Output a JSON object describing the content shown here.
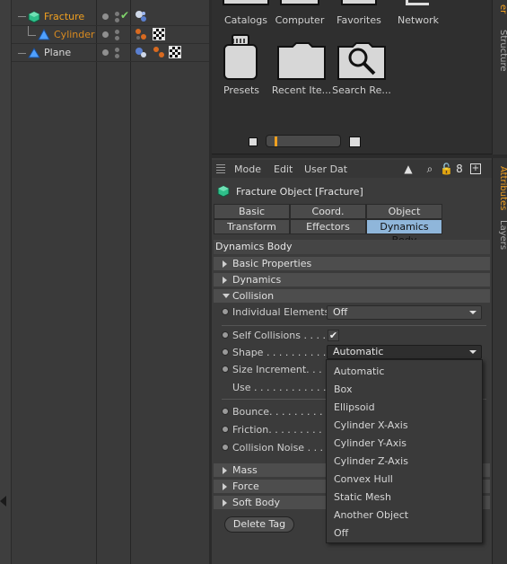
{
  "object_manager": {
    "objects": [
      {
        "name": "Fracture",
        "color": "#f0a020"
      },
      {
        "name": "Cylinder",
        "color": "#d88a20"
      },
      {
        "name": "Plane",
        "color": "#d8d8d8"
      }
    ]
  },
  "content_browser": {
    "items_row1": [
      {
        "label": "Catalogs",
        "icon": "catalogs-icon"
      },
      {
        "label": "Computer",
        "icon": "computer-icon"
      },
      {
        "label": "Favorites",
        "icon": "favorites-icon"
      },
      {
        "label": "Network",
        "icon": "network-icon"
      }
    ],
    "items_row2": [
      {
        "label": "Presets",
        "icon": "presets-jar-icon"
      },
      {
        "label": "Recent Ite...",
        "icon": "folder-icon"
      },
      {
        "label": "Search Re...",
        "icon": "search-folder-icon"
      }
    ]
  },
  "side_tabs": {
    "top": [
      "er",
      "Structure"
    ],
    "bottom": [
      "Attributes",
      "Layers"
    ]
  },
  "attributes": {
    "menu": [
      "Mode",
      "Edit",
      "User Dat"
    ],
    "object_title": "Fracture Object [Fracture]",
    "tabs_row1": [
      "Basic",
      "Coord.",
      "Object"
    ],
    "tabs_row2": [
      "Transform",
      "Effectors",
      "Dynamics Body"
    ],
    "active_tab": "Dynamics Body",
    "section_title": "Dynamics Body",
    "groups_top": [
      "Basic Properties",
      "Dynamics",
      "Collision"
    ],
    "individual_elements": {
      "label": "Individual Elements",
      "value": "Off"
    },
    "self_collisions": {
      "label": "Self Collisions . . . .",
      "checked": "✔"
    },
    "shape": {
      "label": "Shape . . . . . . . . . .",
      "value": "Automatic"
    },
    "size_increment": {
      "label": "Size Increment. . . ."
    },
    "use": {
      "label": "Use . . . . . . . . . . . ."
    },
    "bounce": {
      "label": "Bounce. . . . . . . . . ."
    },
    "friction": {
      "label": "Friction. . . . . . . . . ."
    },
    "collision_noise": {
      "label": "Collision Noise . . ."
    },
    "groups_bottom": [
      "Mass",
      "Force",
      "Soft Body"
    ],
    "delete_tag": "Delete Tag"
  },
  "shape_dropdown_options": [
    "Automatic",
    "Box",
    "Ellipsoid",
    "Cylinder X-Axis",
    "Cylinder Y-Axis",
    "Cylinder Z-Axis",
    "Convex Hull",
    "Static Mesh",
    "Another Object",
    "Off"
  ]
}
